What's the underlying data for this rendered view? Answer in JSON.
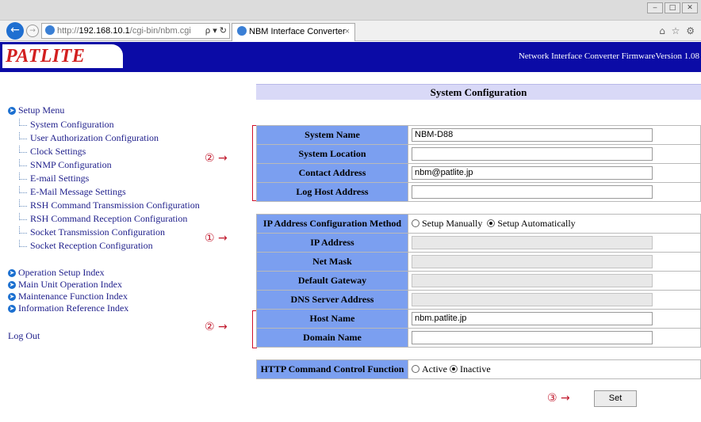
{
  "browser": {
    "address_prefix": "http://",
    "address_host": "192.168.10.1",
    "address_path": "/cgi-bin/nbm.cgi",
    "address_tools": "ρ ▾ ↻",
    "tab_title": "NBM Interface Converter",
    "tab_close": "×",
    "nav_icons": "⌂ ☆ ⚙",
    "win_minimize": "‒",
    "win_restore": "□",
    "win_close": "✕"
  },
  "header": {
    "logo": "PATLITE",
    "info": "Network Interface Converter   FirmwareVersion 1.08"
  },
  "menu": {
    "setup_menu": "Setup Menu",
    "items": [
      "System Configuration",
      "User Authorization Configuration",
      "Clock Settings",
      "SNMP Configuration",
      "E-mail Settings",
      "E-Mail Message Settings",
      "RSH Command Transmission Configuration",
      "RSH Command Reception Configuration",
      "Socket Transmission Configuration",
      "Socket Reception Configuration"
    ],
    "indexes": [
      "Operation Setup Index",
      "Main Unit Operation Index",
      "Maintenance Function Index",
      "Information Reference Index"
    ],
    "logout": "Log Out"
  },
  "annotations": {
    "a1": "② →",
    "a2": "① →",
    "a3": "② →",
    "a4": "③ →"
  },
  "content": {
    "title": "System Configuration",
    "system": {
      "name_label": "System Name",
      "name_value": "NBM-D88",
      "location_label": "System Location",
      "location_value": "",
      "contact_label": "Contact Address",
      "contact_value": "nbm@patlite.jp",
      "loghost_label": "Log Host Address",
      "loghost_value": ""
    },
    "ip": {
      "method_label": "IP Address Configuration Method",
      "method_manual": "Setup Manually",
      "method_auto": "Setup Automatically",
      "method_selected": "auto",
      "ip_label": "IP Address",
      "mask_label": "Net Mask",
      "gateway_label": "Default Gateway",
      "dns_label": "DNS Server Address",
      "host_label": "Host Name",
      "host_value": "nbm.patlite.jp",
      "domain_label": "Domain Name",
      "domain_value": ""
    },
    "http": {
      "label": "HTTP Command Control Function",
      "active": "Active",
      "inactive": "Inactive",
      "selected": "inactive"
    },
    "set_button": "Set"
  }
}
